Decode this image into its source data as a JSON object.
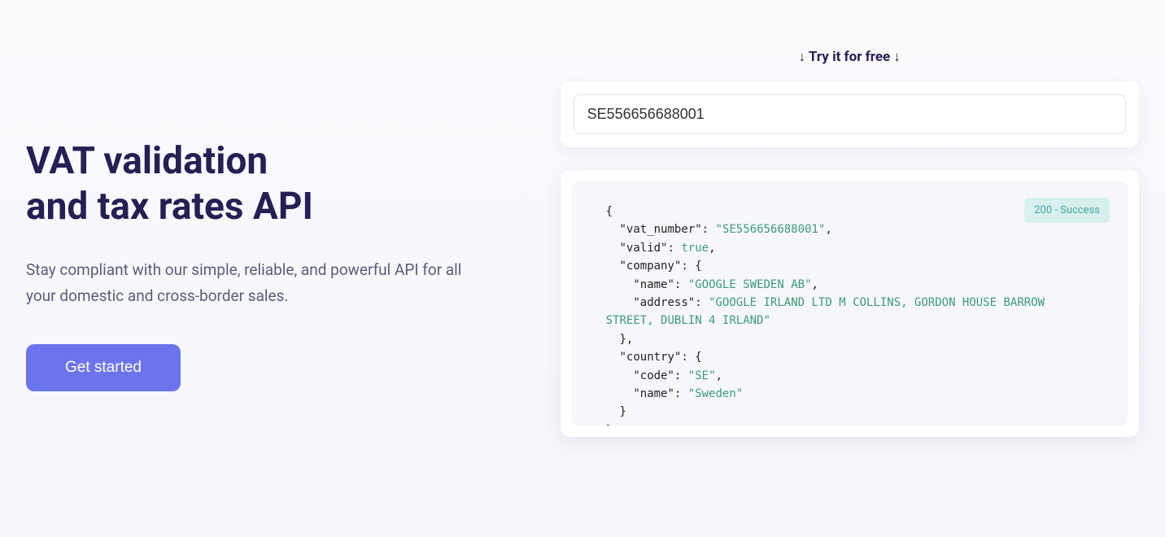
{
  "hero": {
    "headline_line1": "VAT validation",
    "headline_line2": "and tax rates API",
    "subtitle": "Stay compliant with our simple, reliable, and powerful API for all your domestic and cross-border sales.",
    "cta_label": "Get started"
  },
  "demo": {
    "try_label": "↓ Try it for free ↓",
    "input_value": "SE556656688001",
    "status_label": "200 - Success",
    "response": {
      "vat_number": "SE556656688001",
      "valid": true,
      "company": {
        "name": "GOOGLE SWEDEN AB",
        "address": "GOOGLE IRLAND LTD M COLLINS, GORDON HOUSE BARROW STREET, DUBLIN 4 IRLAND"
      },
      "country": {
        "code": "SE",
        "name": "Sweden"
      }
    }
  }
}
